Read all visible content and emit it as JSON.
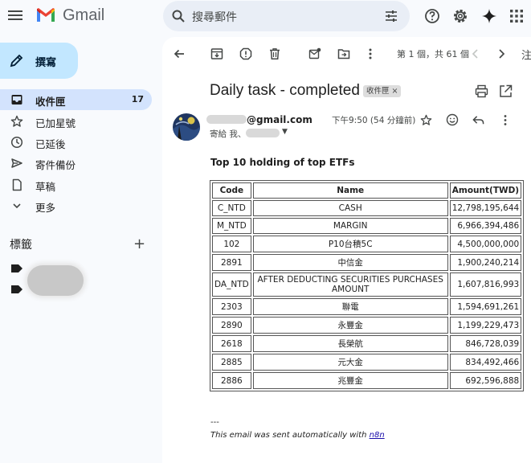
{
  "app": {
    "brand": "Gmail"
  },
  "search": {
    "placeholder": "搜尋郵件"
  },
  "compose": {
    "label": "撰寫"
  },
  "nav": [
    {
      "label": "收件匣",
      "count": "17",
      "icon": "inbox-icon"
    },
    {
      "label": "已加星號",
      "icon": "star-icon"
    },
    {
      "label": "已延後",
      "icon": "clock-icon"
    },
    {
      "label": "寄件備份",
      "icon": "send-icon"
    },
    {
      "label": "草稿",
      "icon": "draft-icon"
    },
    {
      "label": "更多",
      "icon": "chevron-down-icon"
    }
  ],
  "labels": {
    "heading": "標籤",
    "add": "+"
  },
  "toolbar": {
    "pager": "第 1 個，共 61 個",
    "right_cut": "注"
  },
  "email": {
    "subject": "Daily task - completed",
    "chip": "收件匣 ×",
    "sender_domain": "@gmail.com",
    "to_prefix": "寄給 我、",
    "time": "下午9:50 (54 分鐘前)",
    "heading": "Top 10 holding of top ETFs",
    "table": {
      "headers": [
        "Code",
        "Name",
        "Amount(TWD)"
      ],
      "rows": [
        [
          "C_NTD",
          "CASH",
          "12,798,195,644"
        ],
        [
          "M_NTD",
          "MARGIN",
          "6,966,394,486"
        ],
        [
          "102",
          "P10台積5C",
          "4,500,000,000"
        ],
        [
          "2891",
          "中信金",
          "1,900,240,214"
        ],
        [
          "DA_NTD",
          "AFTER DEDUCTING SECURITIES PURCHASES AMOUNT",
          "1,607,816,993"
        ],
        [
          "2303",
          "聯電",
          "1,594,691,261"
        ],
        [
          "2890",
          "永豐金",
          "1,199,229,473"
        ],
        [
          "2618",
          "長榮航",
          "846,728,039"
        ],
        [
          "2885",
          "元大金",
          "834,492,466"
        ],
        [
          "2886",
          "兆豐金",
          "692,596,888"
        ]
      ]
    },
    "footer_dash": "---",
    "footer_text": "This email was sent automatically with ",
    "footer_link": "n8n"
  },
  "colors": {
    "nav_active": "#d3e3fd",
    "compose": "#c2e7ff",
    "search": "#e9eef6"
  }
}
